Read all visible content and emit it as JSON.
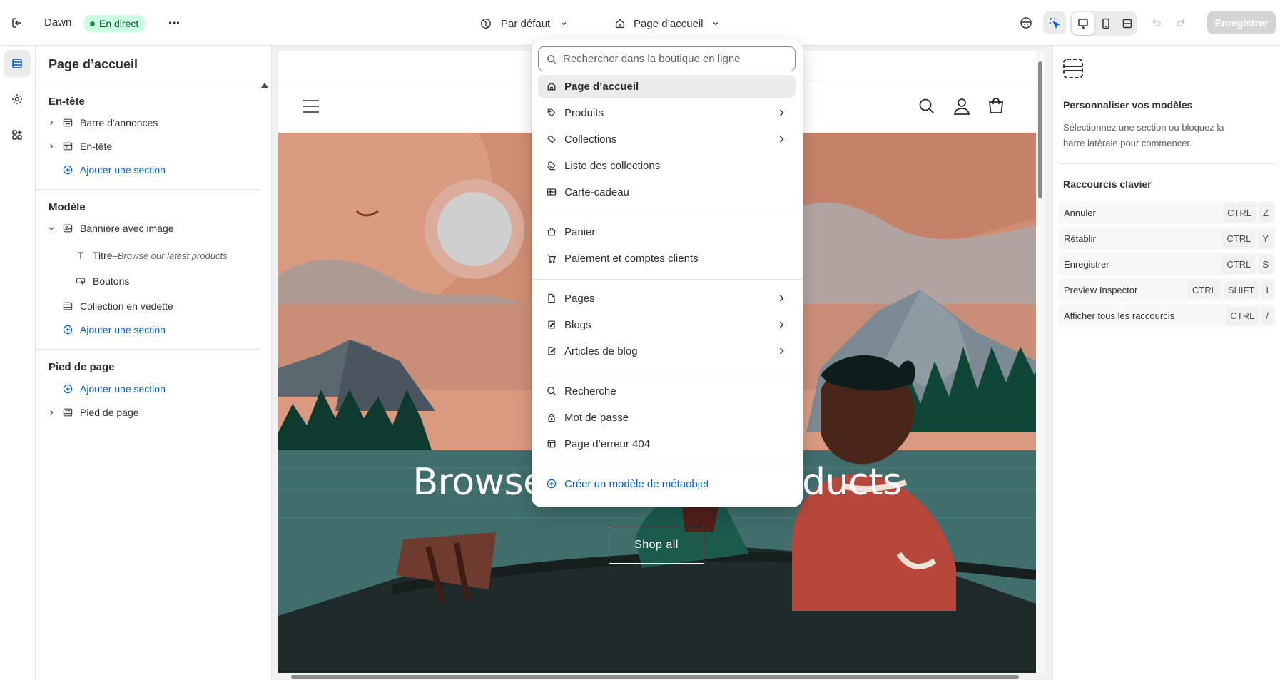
{
  "topbar": {
    "theme_name": "Dawn",
    "live_badge": "En direct",
    "more_label": "···",
    "view_selector": "Par défaut",
    "page_selector": "Page d’accueil",
    "save_label": "Enregistrer"
  },
  "sidebar": {
    "title": "Page d’accueil",
    "groups": {
      "header": {
        "label": "En-tête",
        "items": [
          "Barre d'annonces",
          "En-tête"
        ],
        "add": "Ajouter une section"
      },
      "template": {
        "label": "Modèle",
        "banner": "Bannière avec image",
        "title_block": "Titre",
        "title_block_sep": " – ",
        "title_block_value": "Browse our latest products",
        "buttons_block": "Boutons",
        "featured": "Collection en vedette",
        "add": "Ajouter une section"
      },
      "footer": {
        "label": "Pied de page",
        "add": "Ajouter une section",
        "item": "Pied de page"
      }
    }
  },
  "dropdown": {
    "search_placeholder": "Rechercher dans la boutique en ligne",
    "items": [
      {
        "label": "Page d’accueil",
        "icon": "home-icon",
        "selected": true
      },
      {
        "label": "Produits",
        "icon": "tag-icon",
        "submenu": true
      },
      {
        "label": "Collections",
        "icon": "tags-icon",
        "submenu": true
      },
      {
        "label": "Liste des collections",
        "icon": "collection-list-icon"
      },
      {
        "label": "Carte-cadeau",
        "icon": "gift-card-icon"
      },
      {
        "label": "Panier",
        "icon": "bag-icon"
      },
      {
        "label": "Paiement et comptes clients",
        "icon": "cart-icon"
      },
      {
        "label": "Pages",
        "icon": "page-icon",
        "submenu": true
      },
      {
        "label": "Blogs",
        "icon": "blog-icon",
        "submenu": true
      },
      {
        "label": "Articles de blog",
        "icon": "blog-post-icon",
        "submenu": true
      },
      {
        "label": "Recherche",
        "icon": "search-icon"
      },
      {
        "label": "Mot de passe",
        "icon": "lock-icon"
      },
      {
        "label": "Page d’erreur 404",
        "icon": "error-page-icon"
      }
    ],
    "create_label": "Créer un modèle de métaobjet"
  },
  "preview": {
    "hero_title": "Browse our latest products",
    "hero_button": "Shop all"
  },
  "right_panel": {
    "title": "Personnaliser vos modèles",
    "description": "Sélectionnez une section ou bloquez la barre latérale pour commencer.",
    "shortcuts_title": "Raccourcis clavier",
    "shortcuts": [
      {
        "label": "Annuler",
        "keys": [
          "CTRL",
          "Z"
        ]
      },
      {
        "label": "Rétablir",
        "keys": [
          "CTRL",
          "Y"
        ]
      },
      {
        "label": "Enregistrer",
        "keys": [
          "CTRL",
          "S"
        ]
      },
      {
        "label": "Preview Inspector",
        "keys": [
          "CTRL",
          "SHIFT",
          "I"
        ]
      },
      {
        "label": "Afficher tous les raccourcis",
        "keys": [
          "CTRL",
          "/"
        ]
      }
    ]
  },
  "colors": {
    "accent": "#005bd3",
    "live_bg": "#cdfee1",
    "live_text": "#0c5132"
  }
}
